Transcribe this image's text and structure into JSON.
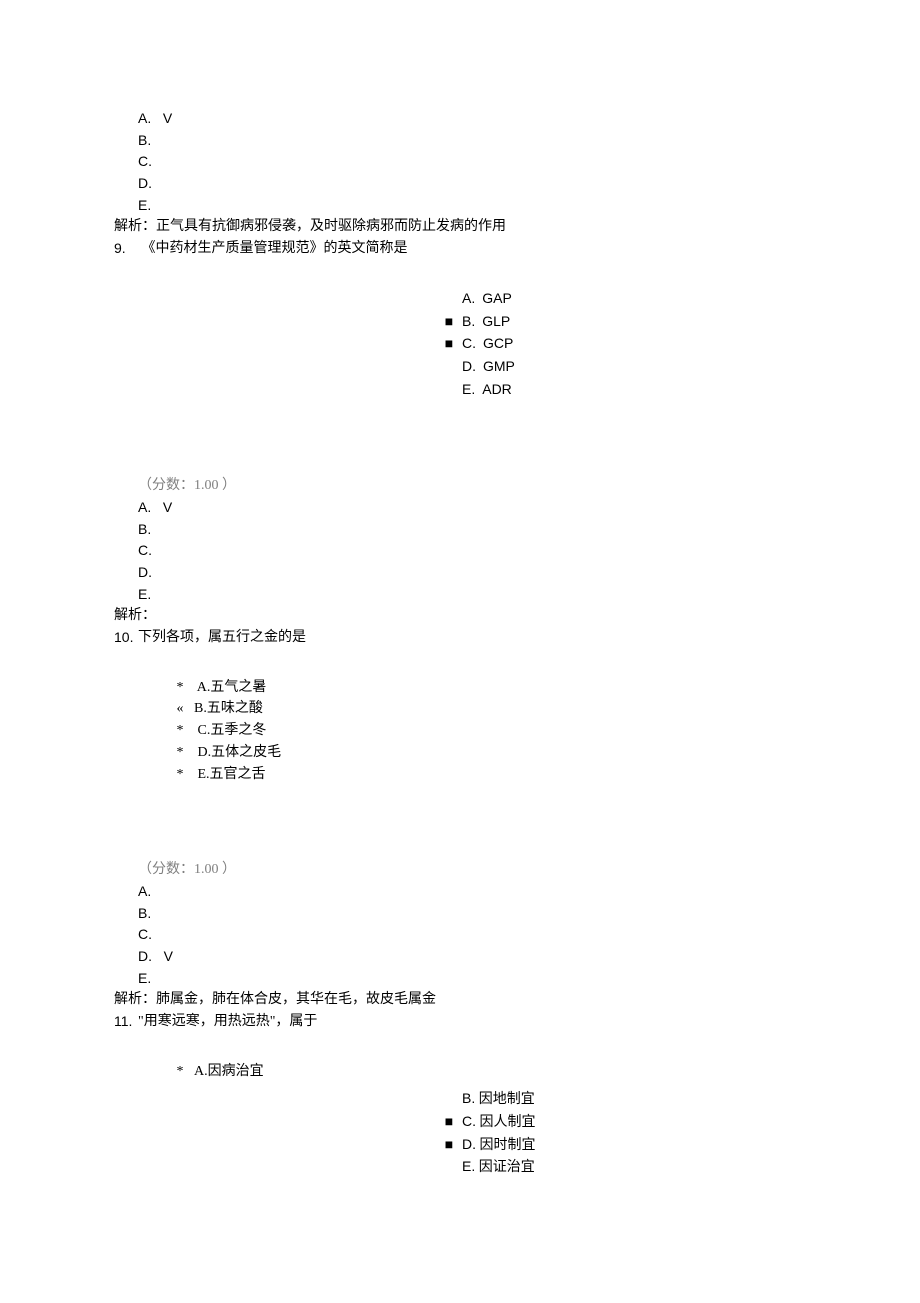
{
  "q8": {
    "ans": {
      "A": "A.   V",
      "B": "B.",
      "C": "C.",
      "D": "D.",
      "E": "E."
    },
    "explain": "解析：正气具有抗御病邪侵袭，及时驱除病邪而防止发病的作用"
  },
  "q9": {
    "num": "9.",
    "text": "  《中药材生产质量管理规范》的英文简称是",
    "opts": {
      "A": {
        "label": "A.",
        "text": "GAP"
      },
      "B": {
        "label": "B.",
        "text": "GLP"
      },
      "C": {
        "label": "C.",
        "text": "GCP"
      },
      "D": {
        "label": "D.",
        "text": "GMP"
      },
      "E": {
        "label": "E.",
        "text": "ADR"
      }
    },
    "score": "（分数：1.00 ）",
    "ans": {
      "A": "A.   V",
      "B": "B.",
      "C": "C.",
      "D": "D.",
      "E": "E."
    },
    "explain": "解析："
  },
  "q10": {
    "num": "10.",
    "text": "下列各项，属五行之金的是",
    "opts": {
      "A": "A.五气之暑",
      "B": "B.五味之酸",
      "C": "C.五季之冬",
      "D": "D.五体之皮毛",
      "E": "E.五官之舌"
    },
    "score": "（分数：1.00 ）",
    "ans": {
      "A": "A.",
      "B": "B.",
      "C": "C.",
      "D": "D.   V",
      "E": "E."
    },
    "explain": "解析：肺属金，肺在体合皮，其华在毛，故皮毛属金"
  },
  "q11": {
    "num": "11.",
    "text": "\"用寒远寒，用热远热\"，属于",
    "optA": {
      "mark": "*",
      "label": "A.因病治宜"
    },
    "opts": {
      "B": {
        "label": "B.",
        "text": "因地制宜"
      },
      "C": {
        "label": "C.",
        "text": "因人制宜"
      },
      "D": {
        "label": "D.",
        "text": "因时制宜"
      },
      "E": {
        "label": "E.",
        "text": "因证治宜"
      }
    }
  },
  "squareBullet": "■"
}
